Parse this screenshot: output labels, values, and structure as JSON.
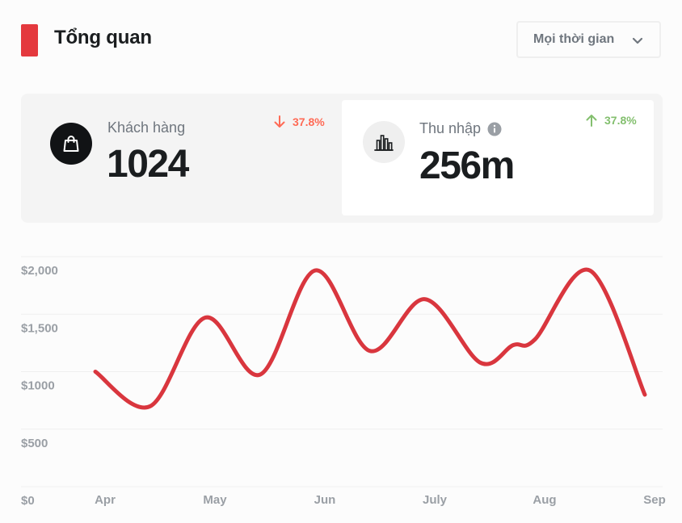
{
  "header": {
    "title": "Tổng quan",
    "accent_color": "#e4393e",
    "period_select": {
      "value": "Mọi thời gian",
      "icon": "chevron-down-icon"
    }
  },
  "stats": {
    "customers": {
      "label": "Khách hàng",
      "value": "1024",
      "change": "37.8%",
      "direction": "down",
      "change_color": "#ff6a55",
      "icon": "shopping-bag-icon"
    },
    "income": {
      "label": "Thu nhập",
      "value": "256m",
      "change": "37.8%",
      "direction": "up",
      "change_color": "#83bf6e",
      "icon": "bar-chart-icon",
      "info_icon": "info-icon"
    }
  },
  "chart_data": {
    "type": "line",
    "x": [
      "Apr",
      "May",
      "Jun",
      "July",
      "Aug",
      "Sep"
    ],
    "y_ticks": [
      "$0",
      "$500",
      "$1000",
      "$1,500",
      "$2,000"
    ],
    "ylim": [
      0,
      2000
    ],
    "grid": true,
    "line_color": "#d9363e",
    "series": [
      {
        "values": [
          {
            "x": 0.0,
            "y": 1000
          },
          {
            "x": 0.5,
            "y": 700
          },
          {
            "x": 1.0,
            "y": 1470
          },
          {
            "x": 1.5,
            "y": 975
          },
          {
            "x": 2.0,
            "y": 1880
          },
          {
            "x": 2.5,
            "y": 1180
          },
          {
            "x": 3.0,
            "y": 1630
          },
          {
            "x": 3.5,
            "y": 1080
          },
          {
            "x": 3.8,
            "y": 1230
          },
          {
            "x": 4.0,
            "y": 1280
          },
          {
            "x": 4.5,
            "y": 1880
          },
          {
            "x": 5.0,
            "y": 800
          }
        ]
      }
    ]
  }
}
